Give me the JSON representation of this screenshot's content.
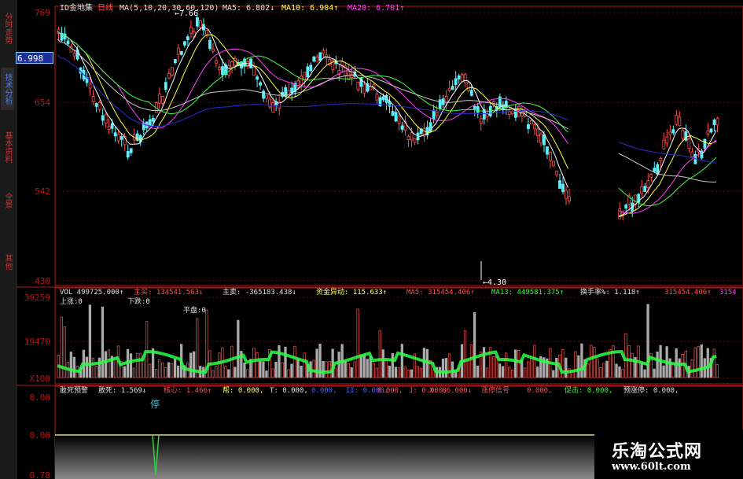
{
  "sidebar": {
    "tabs": [
      {
        "label": "分时走势",
        "active": false
      },
      {
        "label": "技术分析",
        "active": true
      },
      {
        "label": "基本资料",
        "active": false
      },
      {
        "label": "全景",
        "active": false
      },
      {
        "label": "其他",
        "active": false
      }
    ]
  },
  "colors": {
    "background": "#000000",
    "axis_red": "#b01818",
    "grid_red": "#5a0c0c",
    "up_candle": "#ff5050",
    "down_candle": "#5cf0ff",
    "text_white": "#e0e0e0",
    "text_yellow": "#ffff60",
    "text_magenta": "#ff40ff",
    "text_green": "#30ff30",
    "vol_green": "#2cff44",
    "wave_yellow": "#d8d890"
  },
  "price_panel": {
    "header": {
      "stock_name": "ID金地集",
      "period": "日线",
      "ma_spec": "MA(5,10,20,30,60,120)",
      "ma5": "MA5: 6.802↓",
      "ma10": "MA10: 6.904↑",
      "ma20": "MA20: 6.701↑"
    },
    "y_ticks": [
      "769",
      "654",
      "542",
      "430"
    ],
    "current_price": "6.998",
    "high_marker": "7.66",
    "low_marker": "4.30"
  },
  "volume_panel": {
    "header": {
      "vol": "VOL 499725.000↑",
      "main_buy": "主买: 134541.563↓",
      "main_sell": "主卖: -365183.438↓",
      "fund_flow": "资金异动: 115.633↑",
      "ma5": "MA5: 315454.406↑",
      "ma13": "MA13: 449581.375↑",
      "turnover": "换手率%: 1.118↑",
      "tail": "315454.406↑",
      "tail2": "3154"
    },
    "up_label": "上涨:0",
    "down_label": "下跌:0",
    "flat_label": "平盘:0",
    "y_ticks": [
      "39259",
      "19470",
      "X100"
    ]
  },
  "indicator_panel": {
    "header": {
      "name": "敢死预警",
      "gansi": "敢死: 1.569↓",
      "core": "核心: 1.466↑",
      "gang": "帮: 0.000,",
      "t": "T: 0.000,",
      "x1": "0.000,",
      "ii": "II: 0.000,",
      "x2": "0.000,",
      "j": "J: 0.000,",
      "x3": "X: 0.000↓",
      "x4": "X: 86.000↓",
      "limit_up": "涨停信号",
      "x5": "0.000,",
      "promote": "促击: 0.000,",
      "pre_limit": "预涨停: 0.000,"
    },
    "stop_label": "停",
    "y_ticks": [
      "8.00",
      "0.00",
      "0.78"
    ]
  },
  "watermark": {
    "site_name": "乐淘公式网",
    "url": "www.60lt.com"
  }
}
